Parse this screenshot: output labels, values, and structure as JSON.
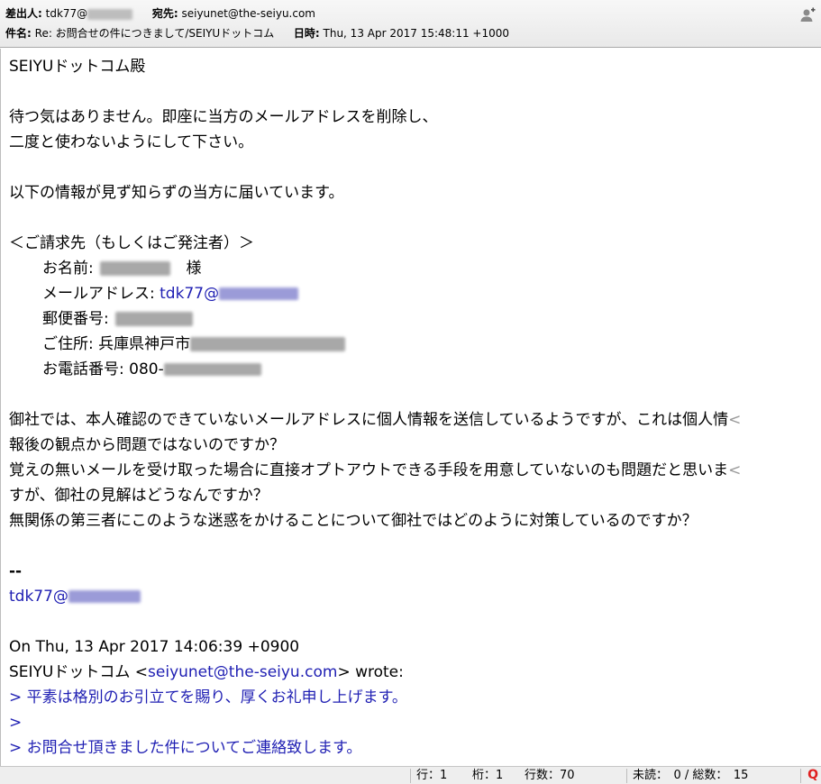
{
  "header": {
    "from_label": "差出人:",
    "from_value": "tdk77@",
    "to_label": "宛先:",
    "to_value": "seiyunet@the-seiyu.com",
    "subject_label": "件名:",
    "subject_value": "Re: お問合せの件につきまして/SEIYUドットコム",
    "date_label": "日時:",
    "date_value": "Thu, 13 Apr 2017 15:48:11 +1000",
    "icon": "person-icon"
  },
  "body": {
    "greeting": "SEIYUドットコム殿",
    "p1_l1": "待つ気はありません。即座に当方のメールアドレスを削除し、",
    "p1_l2": "二度と使わないようにして下さい。",
    "p2": "以下の情報が見ず知らずの当方に届いています。",
    "section_title": "＜ご請求先（もしくはご発注者）＞",
    "name_label": "お名前:",
    "name_suffix": "様",
    "mail_label": "メールアドレス:",
    "mail_value": "tdk77@",
    "zip_label": "郵便番号:",
    "address_label": "ご住所:",
    "address_value": "兵庫県神戸市",
    "phone_label": "お電話番号:",
    "phone_value": "080-",
    "p3_l1": "御社では、本人確認のできていないメールアドレスに個人情報を送信しているようですが、これは個人情",
    "p3_l2": "報後の観点から問題ではないのですか？",
    "p3_l3": "覚えの無いメールを受け取った場合に直接オプトアウトできる手段を用意していないのも問題だと思いま",
    "p3_l4": "すが、御社の見解はどうなんですか？",
    "p3_l5": "無関係の第三者にこのような迷惑をかけることについて御社ではどのように対策しているのですか？",
    "overflow_mark": "<",
    "sig_sep": "--",
    "sig_mail": "tdk77@",
    "quote_header_l1": "On Thu, 13 Apr 2017 14:06:39 +0900",
    "quote_header_prefix": "SEIYUドットコム <",
    "quote_header_mail": "seiyunet@the-seiyu.com",
    "quote_header_suffix": "> wrote:",
    "quote_l1": "> 平素は格別のお引立てを賜り、厚くお礼申し上げます。",
    "quote_l2": ">",
    "quote_l3": "> お問合せ頂きました件についてご連絡致します。"
  },
  "status": {
    "row": "行：1",
    "col": "桁：1",
    "lines": "行数：70",
    "unread": "未読：　0 / 総数：　15",
    "q_icon": "Q"
  }
}
